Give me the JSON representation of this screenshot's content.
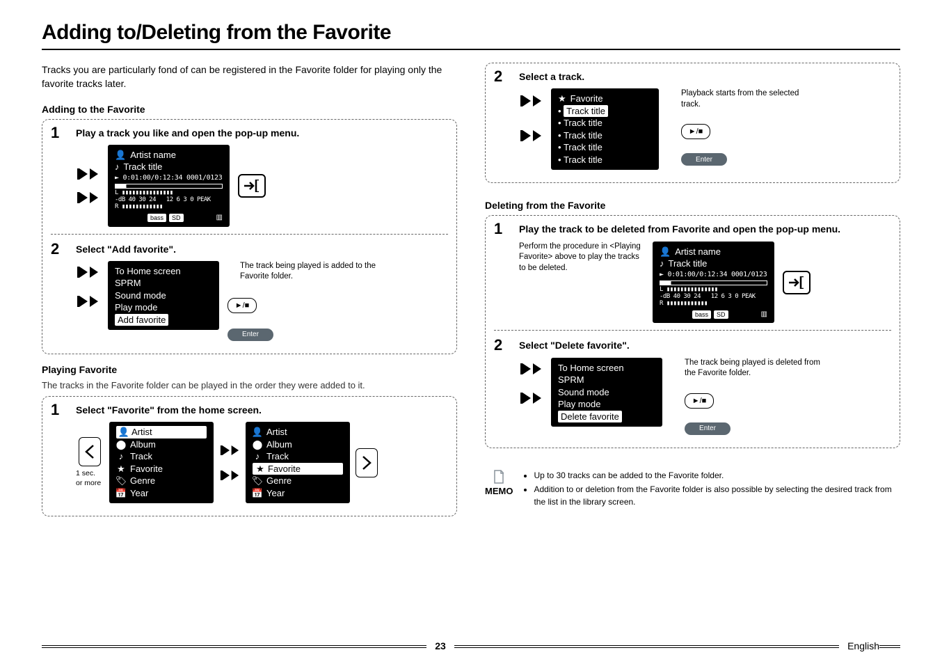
{
  "page_title": "Adding to/Deleting from the Favorite",
  "intro": "Tracks you are particularly fond of can be registered in the Favorite folder for playing only the favorite tracks later.",
  "sec_adding": "Adding to the Favorite",
  "sec_playing_title": "Playing Favorite",
  "sec_playing_desc": "The tracks in the Favorite folder can be played in the order they were added to it.",
  "sec_deleting": "Deleting from the Favorite",
  "add_step1_title": "Play a track you like and open the pop-up menu.",
  "add_step2_title": "Select \"Add favorite\".",
  "add_step2_desc": "The track being played is added to the Favorite folder.",
  "play_step1_title": "Select \"Favorite\" from the home screen.",
  "play_step2_title": "Select a track.",
  "play_step2_desc": "Playback starts from the selected track.",
  "del_step1_title": "Play the track to be deleted from Favorite and open the pop-up menu.",
  "del_step1_desc": "Perform the procedure in <Playing Favorite> above to play the tracks to be deleted.",
  "del_step2_title": "Select \"Delete favorite\".",
  "del_step2_desc": "The track being played is deleted from the Favorite folder.",
  "nowplaying": {
    "artist": "Artist name",
    "track": "Track title",
    "timeline": "► 0:01:00/0:12:34  0001/0123",
    "meters_label": "L\n-dB 40 30 24     12  6 3 0 PEAK\nR",
    "footer_bass": "bass",
    "footer_sd": "SD"
  },
  "popup_menu_add": {
    "items": [
      "To Home screen",
      "SPRM",
      "Sound mode",
      "Play mode",
      "Add favorite"
    ],
    "selected_index": 4
  },
  "popup_menu_del": {
    "items": [
      "To Home screen",
      "SPRM",
      "Sound mode",
      "Play mode",
      "Delete favorite"
    ],
    "selected_index": 4
  },
  "home_items": [
    "Artist",
    "Album",
    "Track",
    "Favorite",
    "Genre",
    "Year"
  ],
  "home_sel_left": 0,
  "home_sel_right": 3,
  "home_hint": "1 sec. or more",
  "favorite_list": {
    "title": "Favorite",
    "items": [
      "Track title",
      "Track title",
      "Track title",
      "Track title",
      "Track title"
    ],
    "selected_index": 0
  },
  "buttons": {
    "play_pause": "►/■",
    "enter": "Enter",
    "popup": "→]"
  },
  "memo": {
    "label": "MEMO",
    "items": [
      "Up to 30 tracks can be added to the Favorite folder.",
      "Addition to or deletion from the Favorite folder is also possible by selecting the desired track from the list in the library screen."
    ]
  },
  "footer": {
    "page": "23",
    "lang": "English"
  }
}
